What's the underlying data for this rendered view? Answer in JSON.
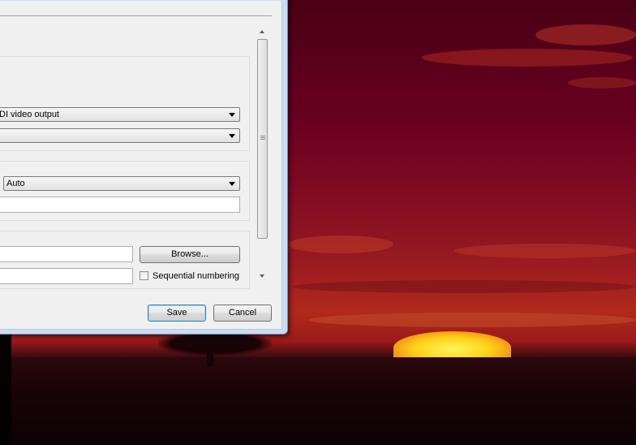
{
  "dialog": {
    "video_output": {
      "selected": "DI video output"
    },
    "video_second_combo": {
      "selected": ""
    },
    "auto_combo": {
      "selected": "Auto"
    },
    "snapshot": {
      "browse_label": "Browse...",
      "sequential_label": "Sequential numbering",
      "sequential_checked": false
    },
    "buttons": {
      "save": "Save",
      "cancel": "Cancel"
    }
  },
  "icons": {
    "combo_arrow": "triangle-down",
    "scroll_up": "triangle-up",
    "scroll_down": "triangle-down",
    "scroll_grip": "grip-lines"
  },
  "colors": {
    "window_frame": "#c9dcf3",
    "dialog_bg": "#f0f0f0",
    "default_button_border": "#3c7fb1",
    "sky_top": "#4a0014",
    "sky_mid": "#a01e20",
    "sun": "#ffd21a"
  }
}
